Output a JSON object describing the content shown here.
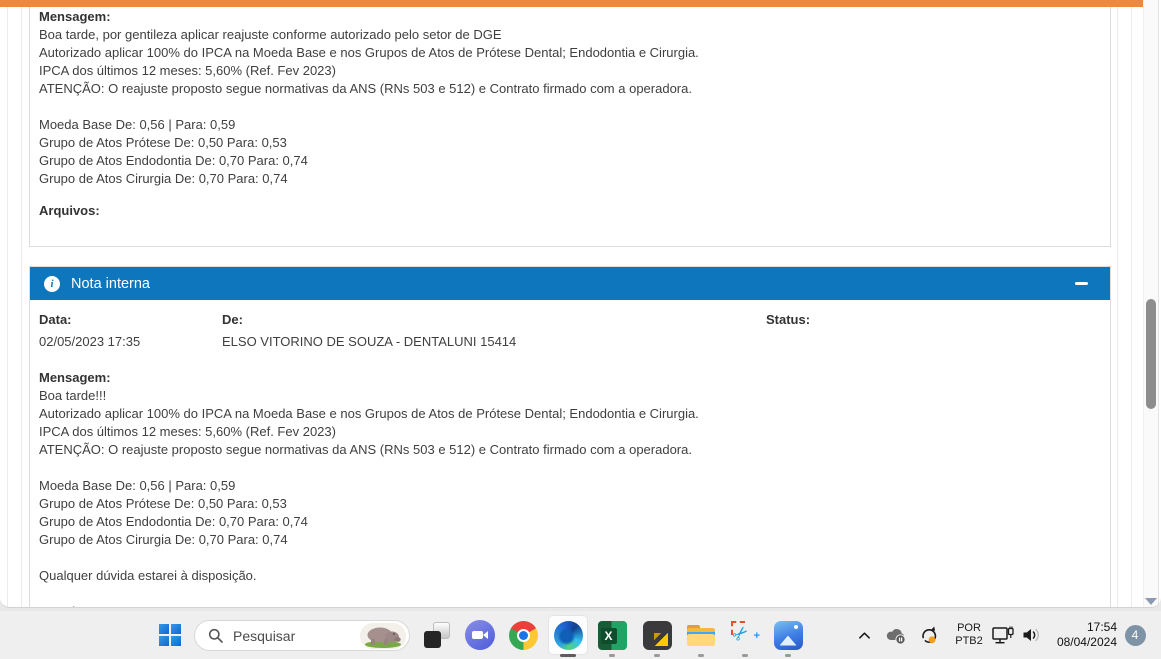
{
  "colors": {
    "topbar": "#EF873D",
    "note_header": "#0E76BD",
    "badge": "#7E93A6"
  },
  "message_card": {
    "title": "Mensagem:",
    "lines": [
      "Boa tarde, por gentileza aplicar reajuste conforme autorizado pelo setor de DGE",
      "Autorizado aplicar 100% do IPCA na Moeda Base e nos Grupos de Atos de Prótese Dental; Endodontia e Cirurgia.",
      "IPCA dos últimos 12 meses: 5,60% (Ref. Fev 2023)",
      "ATENÇÃO: O reajuste proposto segue normativas da ANS (RNs 503 e 512) e Contrato firmado com a operadora.",
      "",
      "Moeda Base De: 0,56 | Para: 0,59",
      "Grupo de Atos Prótese De: 0,50 Para: 0,53",
      "Grupo de Atos Endodontia De: 0,70 Para: 0,74",
      "Grupo de Atos Cirurgia De: 0,70 Para: 0,74"
    ],
    "files_label": "Arquivos:"
  },
  "internal_note": {
    "title": "Nota interna",
    "fields": {
      "data_label": "Data:",
      "data_value": "02/05/2023 17:35",
      "de_label": "De:",
      "de_value": "ELSO VITORINO DE SOUZA - DENTALUNI 15414",
      "status_label": "Status:"
    },
    "message_title": "Mensagem:",
    "lines": [
      "Boa tarde!!!",
      "Autorizado aplicar 100% do IPCA na Moeda Base e nos Grupos de Atos de Prótese Dental; Endodontia e Cirurgia.",
      "IPCA dos últimos 12 meses: 5,60% (Ref. Fev 2023)",
      "ATENÇÃO: O reajuste proposto segue normativas da ANS (RNs 503 e 512) e Contrato firmado com a operadora.",
      "",
      "Moeda Base De: 0,56 | Para: 0,59",
      "Grupo de Atos Prótese De: 0,50 Para: 0,53",
      "Grupo de Atos Endodontia De: 0,70 Para: 0,74",
      "Grupo de Atos Cirurgia De: 0,70 Para: 0,74",
      "",
      "Qualquer dúvida estarei à disposição.",
      "",
      "Atenciosamente,"
    ]
  },
  "taskbar": {
    "search_placeholder": "Pesquisar",
    "icons": {
      "excel_letter": "X",
      "scissors_glyph": "✂",
      "plus_glyph": "+"
    }
  },
  "tray": {
    "language_primary": "POR",
    "language_secondary": "PTB2",
    "time": "17:54",
    "date": "08/04/2024",
    "notification_count": "4"
  },
  "note_header_icons": {
    "info_glyph": "i"
  }
}
